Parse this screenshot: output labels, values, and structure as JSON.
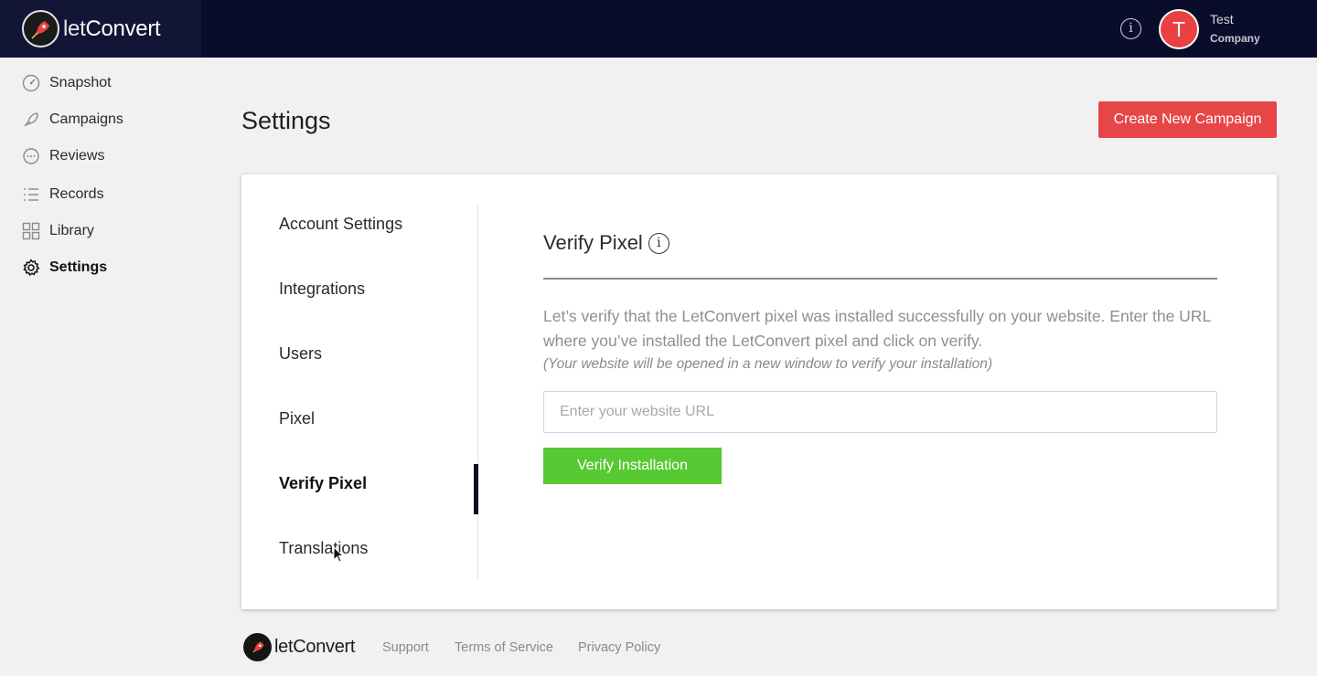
{
  "brand": {
    "name_light": "let",
    "name_bold": "Convert"
  },
  "topbar": {
    "info_icon": "info-circle-icon",
    "avatar_initial": "T",
    "user_name": "Test",
    "user_company": "Company"
  },
  "sidebar": {
    "items": [
      {
        "label": "Snapshot",
        "icon": "speedometer-icon"
      },
      {
        "label": "Campaigns",
        "icon": "rocket-icon"
      },
      {
        "label": "Reviews",
        "icon": "chat-bubble-icon"
      },
      {
        "label": "Records",
        "icon": "list-icon"
      },
      {
        "label": "Library",
        "icon": "grid-icon"
      },
      {
        "label": "Settings",
        "icon": "gear-icon",
        "active": true
      }
    ]
  },
  "page": {
    "title": "Settings",
    "create_button": "Create New Campaign"
  },
  "settings_nav": {
    "items": [
      {
        "label": "Account Settings"
      },
      {
        "label": "Integrations"
      },
      {
        "label": "Users"
      },
      {
        "label": "Pixel"
      },
      {
        "label": "Verify Pixel",
        "active": true
      },
      {
        "label": "Translations"
      }
    ]
  },
  "verify": {
    "title": "Verify Pixel",
    "description": "Let’s verify that the LetConvert pixel was installed successfully on your website. Enter the URL where you’ve installed the LetConvert pixel and click on verify.",
    "note": "(Your website will be opened in a new window to verify your installation)",
    "url_placeholder": "Enter your website URL",
    "url_value": "",
    "button": "Verify Installation"
  },
  "footer": {
    "links": [
      "Support",
      "Terms of Service",
      "Privacy Policy"
    ]
  },
  "colors": {
    "topbar_bg": "#0a0c2c",
    "primary_red": "#e84646",
    "verify_green": "#57c932",
    "active_indicator": "#0d0e2a"
  }
}
